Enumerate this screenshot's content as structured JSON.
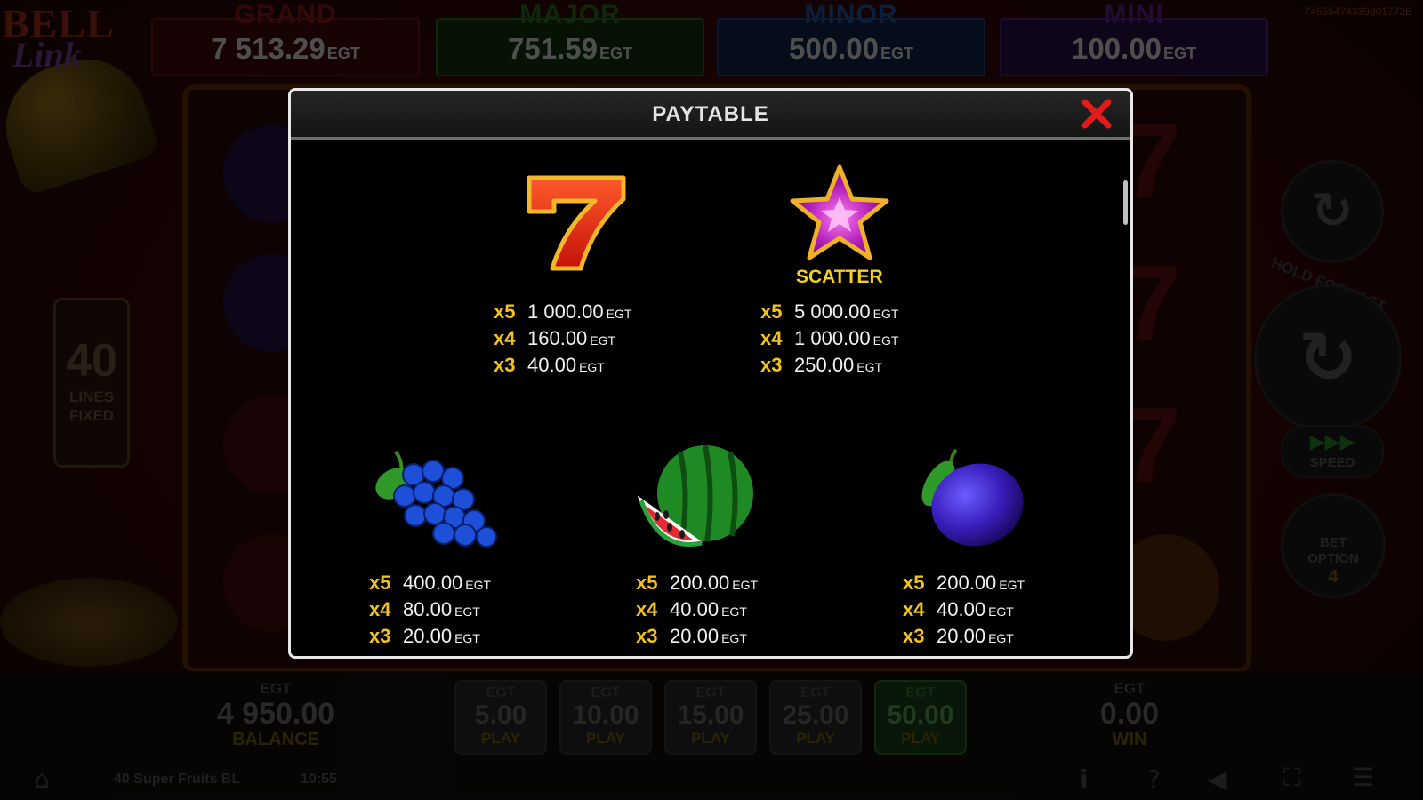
{
  "logo": {
    "line1": "BELL",
    "line2": "Link"
  },
  "session_id": "74555474339801772B",
  "jackpots": [
    {
      "title": "GRAND",
      "value": "7 513.29",
      "currency": "EGT",
      "color": "#b1231c"
    },
    {
      "title": "MAJOR",
      "value": "751.59",
      "currency": "EGT",
      "color": "#2f8a2a"
    },
    {
      "title": "MINOR",
      "value": "500.00",
      "currency": "EGT",
      "color": "#2267b8"
    },
    {
      "title": "MINI",
      "value": "100.00",
      "currency": "EGT",
      "color": "#7a2aa5"
    }
  ],
  "lines": {
    "count": "40",
    "label1": "LINES",
    "label2": "FIXED"
  },
  "controls": {
    "hold_text": "HOLD FOR FAST PLAY",
    "speed_label": "SPEED",
    "bet_option_label1": "BET",
    "bet_option_label2": "OPTION",
    "bet_option_value": "4"
  },
  "balance": {
    "currency": "EGT",
    "amount": "4 950.00",
    "label": "BALANCE"
  },
  "win": {
    "currency": "EGT",
    "amount": "0.00",
    "label": "WIN"
  },
  "bets": [
    {
      "currency": "EGT",
      "amount": "5.00",
      "label": "PLAY"
    },
    {
      "currency": "EGT",
      "amount": "10.00",
      "label": "PLAY"
    },
    {
      "currency": "EGT",
      "amount": "15.00",
      "label": "PLAY"
    },
    {
      "currency": "EGT",
      "amount": "25.00",
      "label": "PLAY"
    },
    {
      "currency": "EGT",
      "amount": "50.00",
      "label": "PLAY",
      "selected": true
    }
  ],
  "status": {
    "game_name": "40 Super Fruits BL",
    "time": "10:55"
  },
  "icons": [
    "home-icon",
    "info-icon",
    "help-icon",
    "sound-icon",
    "fullscreen-icon",
    "menu-icon"
  ],
  "paytable": {
    "title": "PAYTABLE",
    "close_icon": "close-icon",
    "symbols": [
      {
        "name": "seven",
        "payouts": [
          {
            "mult": "x5",
            "amount": "1 000.00",
            "currency": "EGT"
          },
          {
            "mult": "x4",
            "amount": "160.00",
            "currency": "EGT"
          },
          {
            "mult": "x3",
            "amount": "40.00",
            "currency": "EGT"
          }
        ]
      },
      {
        "name": "star",
        "label": "SCATTER",
        "payouts": [
          {
            "mult": "x5",
            "amount": "5 000.00",
            "currency": "EGT"
          },
          {
            "mult": "x4",
            "amount": "1 000.00",
            "currency": "EGT"
          },
          {
            "mult": "x3",
            "amount": "250.00",
            "currency": "EGT"
          }
        ]
      },
      {
        "name": "grapes",
        "payouts": [
          {
            "mult": "x5",
            "amount": "400.00",
            "currency": "EGT"
          },
          {
            "mult": "x4",
            "amount": "80.00",
            "currency": "EGT"
          },
          {
            "mult": "x3",
            "amount": "20.00",
            "currency": "EGT"
          }
        ]
      },
      {
        "name": "watermelon",
        "payouts": [
          {
            "mult": "x5",
            "amount": "200.00",
            "currency": "EGT"
          },
          {
            "mult": "x4",
            "amount": "40.00",
            "currency": "EGT"
          },
          {
            "mult": "x3",
            "amount": "20.00",
            "currency": "EGT"
          }
        ]
      },
      {
        "name": "plum",
        "payouts": [
          {
            "mult": "x5",
            "amount": "200.00",
            "currency": "EGT"
          },
          {
            "mult": "x4",
            "amount": "40.00",
            "currency": "EGT"
          },
          {
            "mult": "x3",
            "amount": "20.00",
            "currency": "EGT"
          }
        ]
      }
    ]
  }
}
